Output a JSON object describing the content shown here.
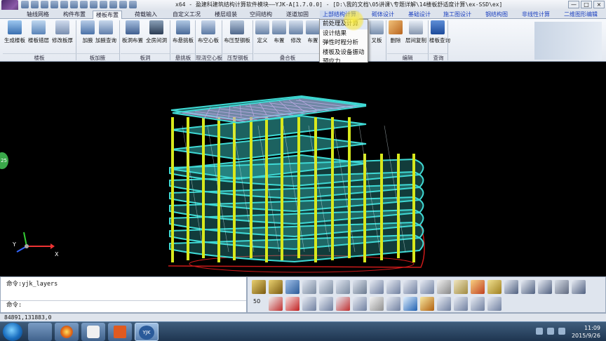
{
  "window": {
    "title": "x64 - 盈建科建筑结构计算软件模块——YJK-A[1.7.0.0] - [D:\\我的文档\\05讲课\\专题详解\\14楼板舒适度计算\\ex-SSD\\ex]",
    "controls": [
      "—",
      "□",
      "×"
    ]
  },
  "tabs": [
    {
      "label": "轴线网格"
    },
    {
      "label": "构件布置"
    },
    {
      "label": "楼板布置"
    },
    {
      "label": "荷载输入"
    },
    {
      "label": "自定义工况"
    },
    {
      "label": "楼层组装"
    },
    {
      "label": "空间结构"
    },
    {
      "label": "遂道加固"
    },
    {
      "label": "上部结构计算"
    },
    {
      "label": "砌体设计"
    },
    {
      "label": "基础设计"
    },
    {
      "label": "施工图设计"
    },
    {
      "label": "钢结构图"
    },
    {
      "label": "非线性计算"
    },
    {
      "label": "二维图形编辑"
    }
  ],
  "ribbon": {
    "buttons": [
      {
        "label": "生成楼板"
      },
      {
        "label": "楼板错层"
      },
      {
        "label": "修改板厚"
      },
      {
        "label": "加腋"
      },
      {
        "label": "加腋查询"
      },
      {
        "label": "板洞布置"
      },
      {
        "label": "全房间洞"
      },
      {
        "label": "布悬挑板"
      },
      {
        "label": "布空心板"
      },
      {
        "label": "布压型钢板"
      },
      {
        "label": "定义"
      },
      {
        "label": "布置"
      },
      {
        "label": "修改"
      },
      {
        "label": "布置"
      },
      {
        "label": "叉板"
      },
      {
        "label": "删除"
      },
      {
        "label": "层间复制"
      },
      {
        "label": "楼板查询"
      }
    ],
    "groups": [
      "楼板",
      "板加腋",
      "板洞",
      "悬挑板",
      "现浇空心板",
      "压型钢板",
      "叠合板",
      "编辑",
      "查询"
    ]
  },
  "menu": {
    "items": [
      {
        "label": "前处理及计算"
      },
      {
        "label": "设计结果"
      },
      {
        "label": "弹性时程分析"
      },
      {
        "label": "楼板及设备振动"
      },
      {
        "label": "预应力"
      }
    ]
  },
  "viewport": {
    "axis_x_label": "X",
    "axis_y_label": "Y",
    "side_badge": "25",
    "colors": {
      "column": "#d8e81c",
      "slab": "#3fd9d4",
      "wire": "#d7e8ec",
      "roof_mesh": "#b8a8e0",
      "ground": "#cc1a1a"
    }
  },
  "command": {
    "line1": "命令:yjk_layers",
    "line2": "命令:"
  },
  "status": {
    "coords": "84891,131883,0"
  },
  "toolbar": {
    "scale_label": "50"
  },
  "taskbar": {
    "time": "11:09",
    "date": "2015/9/26",
    "app_yjk": "YJK"
  }
}
